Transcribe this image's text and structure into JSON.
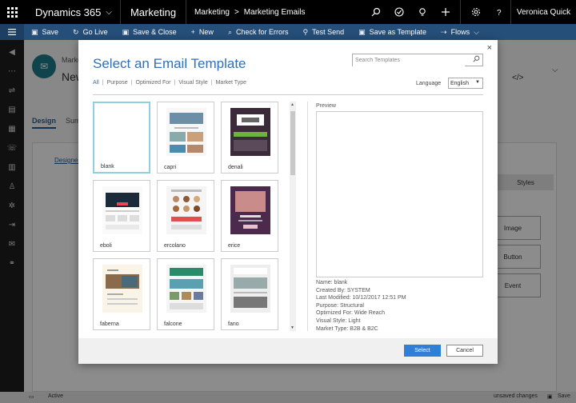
{
  "topbar": {
    "brand": "Dynamics 365",
    "module": "Marketing",
    "breadcrumb": [
      "Marketing",
      "Marketing Emails"
    ],
    "breadcrumb_sep": ">",
    "user": "Veronica Quick"
  },
  "commandbar": {
    "items": [
      {
        "label": "Save",
        "icon": "save-icon"
      },
      {
        "label": "Go Live",
        "icon": "go-live-icon"
      },
      {
        "label": "Save & Close",
        "icon": "save-close-icon"
      },
      {
        "label": "New",
        "icon": "plus-icon"
      },
      {
        "label": "Check for Errors",
        "icon": "check-errors-icon"
      },
      {
        "label": "Test Send",
        "icon": "test-send-icon"
      },
      {
        "label": "Save as Template",
        "icon": "save-template-icon"
      },
      {
        "label": "Flows",
        "icon": "flows-icon"
      }
    ]
  },
  "background": {
    "entity_label": "Marke",
    "record_name": "New",
    "tab_design": "Design",
    "tab_summary": "Sum",
    "designer_link": "Designer",
    "styles_label": "Styles",
    "tools": [
      "Image",
      "Button",
      "Event"
    ]
  },
  "status": {
    "active": "Active",
    "unsaved": "unsaved changes",
    "save": "Save"
  },
  "dialog": {
    "title": "Select an Email Template",
    "close": "×",
    "search_placeholder": "Search Templates",
    "filters": [
      {
        "label": "All",
        "active": true
      },
      {
        "label": "Purpose",
        "active": false
      },
      {
        "label": "Optimized For",
        "active": false
      },
      {
        "label": "Visual Style",
        "active": false
      },
      {
        "label": "Market Type",
        "active": false
      }
    ],
    "filter_sep": "|",
    "language_label": "Language",
    "language_value": "English",
    "templates": [
      {
        "name": "blank",
        "selected": true
      },
      {
        "name": "capri",
        "selected": false
      },
      {
        "name": "denali",
        "selected": false
      },
      {
        "name": "eboli",
        "selected": false
      },
      {
        "name": "ercolano",
        "selected": false
      },
      {
        "name": "erice",
        "selected": false
      },
      {
        "name": "faberna",
        "selected": false
      },
      {
        "name": "falcone",
        "selected": false
      },
      {
        "name": "fano",
        "selected": false
      }
    ],
    "preview_label": "Preview",
    "meta": {
      "name": "Name: blank",
      "created_by": "Created By: SYSTEM",
      "last_modified": "Last Modified: 10/12/2017 12:51 PM",
      "purpose": "Purpose: Structural",
      "optimized_for": "Optimized For: Wide Reach",
      "visual_style": "Visual Style: Light",
      "market_type": "Market Type: B2B & B2C"
    },
    "select_button": "Select",
    "cancel_button": "Cancel"
  }
}
